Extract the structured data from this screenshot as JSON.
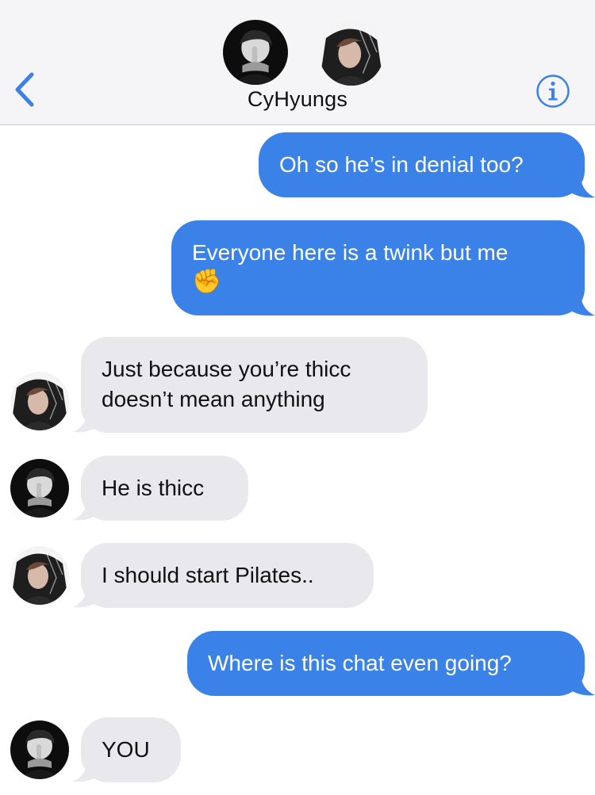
{
  "header": {
    "title": "CyHyungs",
    "back_icon": "chevron-left-icon",
    "info_icon": "info-icon",
    "accent": "#3b82e8"
  },
  "messages": [
    {
      "direction": "sent",
      "text": "Oh so he’s in denial too?"
    },
    {
      "direction": "sent",
      "text": "Everyone here is a twink but me",
      "emoji": "✊"
    },
    {
      "direction": "received",
      "sender_avatar": "avatar-b",
      "line1": "Just because you’re thicc",
      "line2": "doesn’t mean anything"
    },
    {
      "direction": "received",
      "sender_avatar": "avatar-a",
      "text": "He is thicc"
    },
    {
      "direction": "received",
      "sender_avatar": "avatar-b",
      "text": "I should start Pilates.."
    },
    {
      "direction": "sent",
      "text": "Where is this chat even going?"
    },
    {
      "direction": "received",
      "sender_avatar": "avatar-a",
      "text": "YOU"
    }
  ],
  "colors": {
    "sent_bubble": "#3b82e8",
    "received_bubble": "#e8e8ed",
    "header_bg": "#f5f5f7"
  }
}
